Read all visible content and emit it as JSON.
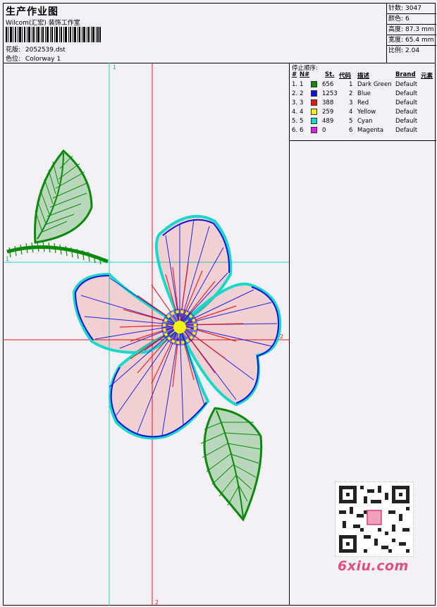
{
  "header": {
    "title": "生产作业图",
    "subtitle": "Wilcom(汇宏) 装饰工作室",
    "pattern_label": "花版:",
    "pattern_value": "2052539.dst",
    "colorway_label": "色位:",
    "colorway_value": "Colorway 1"
  },
  "stats": [
    {
      "label": "针数:",
      "value": "3047"
    },
    {
      "label": "颜色:",
      "value": "6"
    },
    {
      "label": "高度:",
      "value": "87.3 mm"
    },
    {
      "label": "宽度:",
      "value": "65.4 mm"
    },
    {
      "label": "比例:",
      "value": "2.04"
    }
  ],
  "legend": {
    "title": "停止顺序:",
    "headers": {
      "hash": "#",
      "n": "N#",
      "st": "St.",
      "code": "代码",
      "desc": "描述",
      "brand": "Brand",
      "elem": "元素"
    },
    "rows": [
      {
        "idx": "1.",
        "n": "1",
        "color": "#0a8a0a",
        "st": "656",
        "code": "1",
        "desc": "Dark Green",
        "brand": "Default"
      },
      {
        "idx": "2.",
        "n": "2",
        "color": "#1010e0",
        "st": "1253",
        "code": "2",
        "desc": "Blue",
        "brand": "Default"
      },
      {
        "idx": "3.",
        "n": "3",
        "color": "#ee1111",
        "st": "388",
        "code": "3",
        "desc": "Red",
        "brand": "Default"
      },
      {
        "idx": "4.",
        "n": "4",
        "color": "#f2f20a",
        "st": "259",
        "code": "4",
        "desc": "Yellow",
        "brand": "Default"
      },
      {
        "idx": "5.",
        "n": "5",
        "color": "#18d8c8",
        "st": "489",
        "code": "5",
        "desc": "Cyan",
        "brand": "Default"
      },
      {
        "idx": "6.",
        "n": "6",
        "color": "#e818e8",
        "st": "0",
        "code": "6",
        "desc": "Magenta",
        "brand": "Default"
      }
    ]
  },
  "guides": {
    "cyan_v": "1",
    "cyan_h": "1",
    "red_h": "2",
    "red_v": "2"
  },
  "watermark": "6xiu.com",
  "colors": {
    "green": "#0a8a0a",
    "blue": "#1010e0",
    "red": "#ee1111",
    "yellow": "#f2f20a",
    "cyan": "#18d8c8"
  }
}
